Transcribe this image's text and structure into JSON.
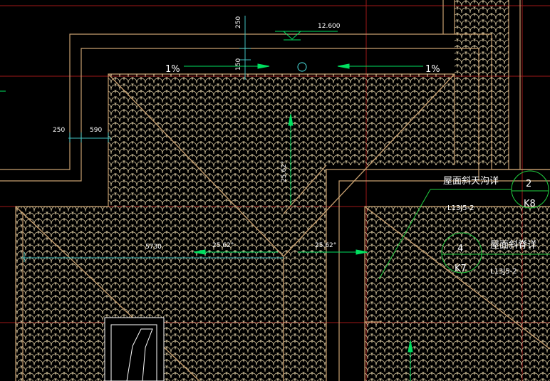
{
  "colors": {
    "background": "#000000",
    "roof_outline": "#c8a070",
    "tile_pattern": "#d8c8a0",
    "dimension_green": "#00e060",
    "dimension_cyan": "#40c0c0",
    "red_grid": "#a01818",
    "leader_green": "#20d040",
    "text": "#ffffff"
  },
  "annotations": {
    "elevation": "12.600",
    "slope_left": "1%",
    "slope_right": "1%",
    "dim_250_top": "250",
    "dim_150": "150",
    "dim_250_left": "250",
    "dim_590": "590",
    "dim_5730": "5730",
    "angle_vertical": "25.62°",
    "angle_left": "25.62°",
    "angle_right": "25.62°"
  },
  "callouts": {
    "valley": {
      "title": "屋面斜天沟详",
      "ref": "L13J5-2",
      "number": "2",
      "sheet": "K8"
    },
    "ridge": {
      "title": "屋面斜脊详",
      "ref": "L13J5-2",
      "number": "4",
      "sheet": "K7"
    }
  },
  "icons": {
    "elevation_marker": "triangle-elevation-icon",
    "drain_marker": "circle-drain-icon"
  }
}
